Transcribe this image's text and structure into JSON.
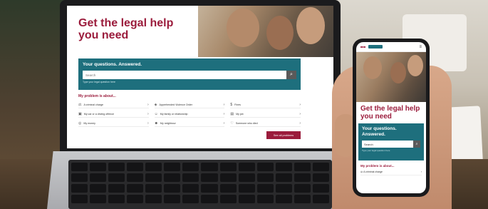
{
  "site": {
    "hero_title": "Get the legal help you need",
    "search_heading": "Your questions. Answered.",
    "search_placeholder": "Search",
    "search_hint": "Type your legal question here",
    "search_button_icon": "search-icon",
    "problem_label": "My problem is about...",
    "problems": [
      {
        "label": "A criminal charge",
        "icon": "gavel-icon"
      },
      {
        "label": "Apprehended Violence Order",
        "icon": "shield-icon"
      },
      {
        "label": "Fines",
        "icon": "dollar-icon"
      },
      {
        "label": "My car or a driving offence",
        "icon": "car-icon"
      },
      {
        "label": "My family or relationship",
        "icon": "family-icon"
      },
      {
        "label": "My job",
        "icon": "briefcase-icon"
      },
      {
        "label": "My money",
        "icon": "money-icon"
      },
      {
        "label": "My neighbour",
        "icon": "people-icon"
      },
      {
        "label": "Someone who died",
        "icon": "heart-icon"
      }
    ],
    "see_all_label": "See all problems"
  },
  "phone": {
    "hero_title": "Get the legal help you need",
    "search_heading": "Your questions. Answered.",
    "search_placeholder": "Search",
    "search_hint": "Type your legal question here",
    "problem_label": "My problem is about...",
    "first_problem": "A criminal charge"
  }
}
